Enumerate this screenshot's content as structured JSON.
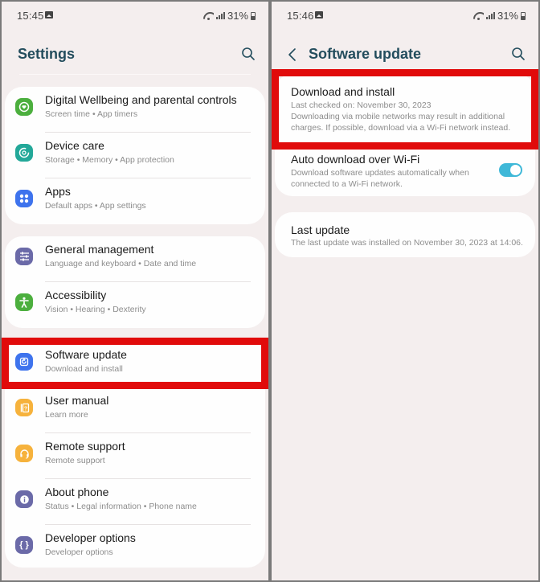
{
  "left": {
    "status": {
      "time": "15:45",
      "battery": "31%"
    },
    "header": {
      "title": "Settings"
    },
    "groups": [
      {
        "items": [
          {
            "title": "Digital Wellbeing and parental controls",
            "subtitle": "Screen time  •  App timers",
            "icon": "digital-wellbeing-icon",
            "color": "#4caf3e"
          },
          {
            "title": "Device care",
            "subtitle": "Storage  •  Memory  •  App protection",
            "icon": "device-care-icon",
            "color": "#23a899"
          },
          {
            "title": "Apps",
            "subtitle": "Default apps  •  App settings",
            "icon": "apps-icon",
            "color": "#3e73ed"
          }
        ]
      },
      {
        "items": [
          {
            "title": "General management",
            "subtitle": "Language and keyboard  •  Date and time",
            "icon": "general-management-icon",
            "color": "#6b6aa8"
          },
          {
            "title": "Accessibility",
            "subtitle": "Vision  •  Hearing  •  Dexterity",
            "icon": "accessibility-icon",
            "color": "#4caf3e"
          }
        ]
      },
      {
        "items": [
          {
            "title": "Software update",
            "subtitle": "Download and install",
            "icon": "software-update-icon",
            "color": "#3e73ed"
          },
          {
            "title": "User manual",
            "subtitle": "Learn more",
            "icon": "user-manual-icon",
            "color": "#f6b23c"
          },
          {
            "title": "Remote support",
            "subtitle": "Remote support",
            "icon": "remote-support-icon",
            "color": "#f6b23c"
          },
          {
            "title": "About phone",
            "subtitle": "Status  •  Legal information  •  Phone name",
            "icon": "about-phone-icon",
            "color": "#6b6aa8"
          },
          {
            "title": "Developer options",
            "subtitle": "Developer options",
            "icon": "developer-options-icon",
            "color": "#6b6aa8"
          }
        ]
      }
    ],
    "icon_glyphs": {
      "user_manual": "?",
      "about_phone": "i",
      "developer_options": "{ }"
    }
  },
  "right": {
    "status": {
      "time": "15:46",
      "battery": "31%"
    },
    "header": {
      "title": "Software update"
    },
    "download": {
      "title": "Download and install",
      "last_checked": "Last checked on: November 30, 2023",
      "warning": "Downloading via mobile networks may result in additional charges. If possible, download via a Wi-Fi network instead."
    },
    "auto_download": {
      "title": "Auto download over Wi-Fi",
      "subtitle": "Download software updates automatically when connected to a Wi-Fi network.",
      "enabled": true
    },
    "last_update": {
      "title": "Last update",
      "subtitle": "The last update was installed on November 30, 2023 at 14:06."
    }
  },
  "colors": {
    "highlight": "#e10b0b",
    "title": "#234d5d",
    "toggle_on": "#3fb8d8",
    "background": "#f4eeee"
  }
}
